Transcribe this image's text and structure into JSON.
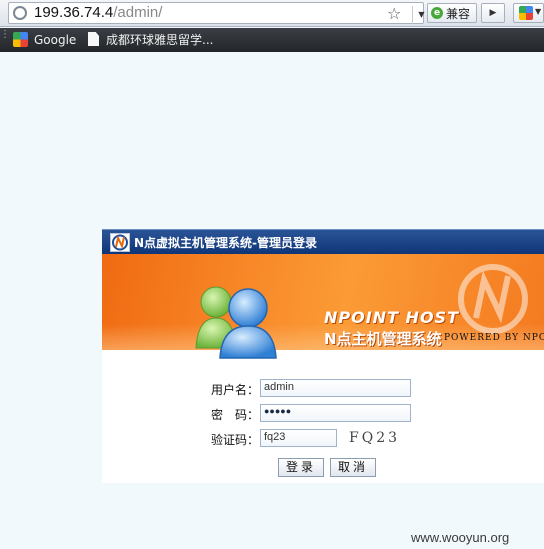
{
  "browser": {
    "url_host": "199.36.74.4",
    "url_path": "/admin/",
    "compat_label": "兼容",
    "bookmarks": [
      {
        "label": "Google"
      },
      {
        "label": "成都环球雅思留学..."
      }
    ]
  },
  "login": {
    "title": "N点虚拟主机管理系统-管理员登录",
    "brand_en": "NPOINT HOST",
    "brand_cn": "N点主机管理系统",
    "powered_by": "POWERED BY NPOINT",
    "fields": {
      "username_label": "用户名：",
      "username_value": "admin",
      "password_label": "密　码：",
      "password_value": "●●●●●",
      "captcha_label": "验证码：",
      "captcha_value": "fq23",
      "captcha_image_text": "FQ23"
    },
    "buttons": {
      "login": "登录",
      "cancel": "取消"
    }
  },
  "watermark": "www.wooyun.org",
  "colors": {
    "titlebar": "#1a4385",
    "banner": "#f88a2a",
    "page_bg": "#f2f9fd"
  }
}
